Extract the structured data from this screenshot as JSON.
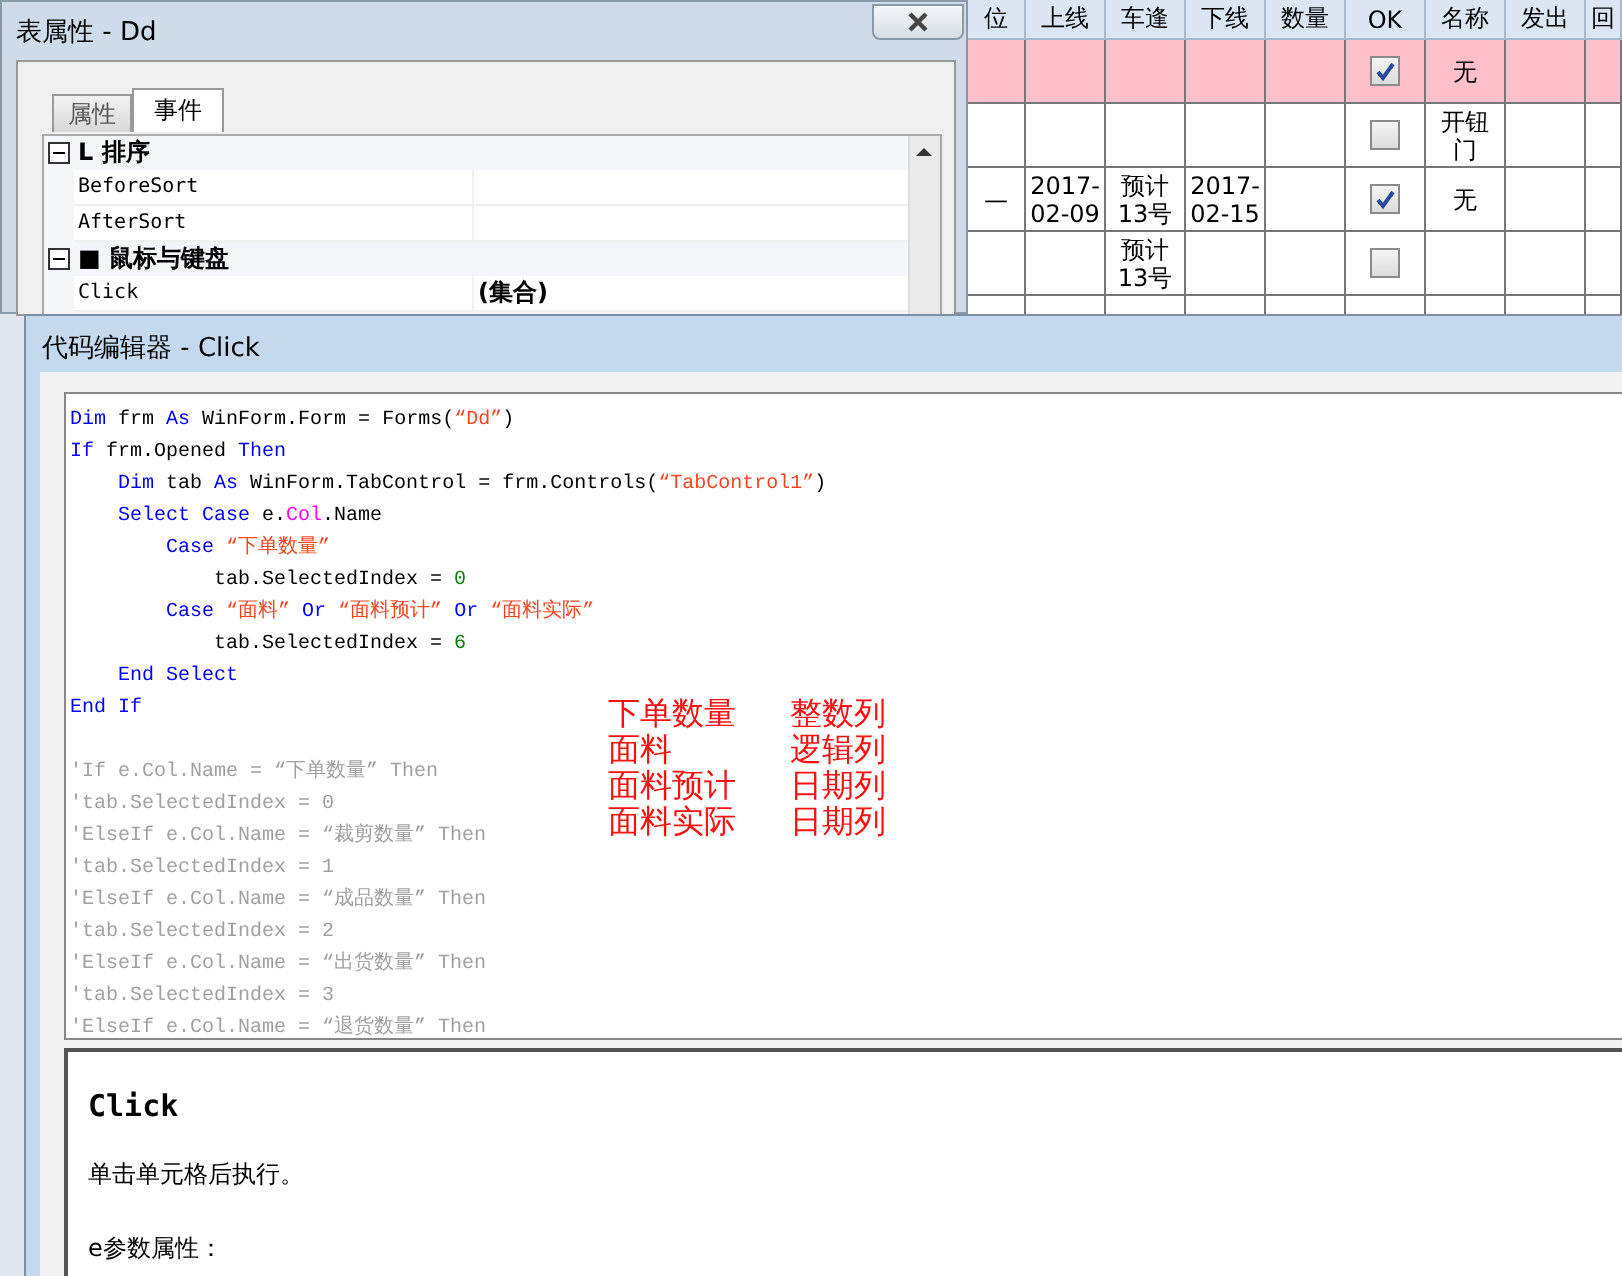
{
  "background_grid": {
    "columns": [
      "位",
      "上线",
      "车逢",
      "下线",
      "数量",
      "OK",
      "名称",
      "发出",
      "回"
    ],
    "rows": [
      {
        "selected": true,
        "cells": [
          {
            "kind": "empty"
          },
          {
            "kind": "empty"
          },
          {
            "kind": "empty"
          },
          {
            "kind": "empty"
          },
          {
            "kind": "empty"
          },
          {
            "kind": "check",
            "checked": true
          },
          {
            "kind": "text",
            "text": "无"
          },
          {
            "kind": "empty"
          },
          {
            "kind": "empty"
          }
        ]
      },
      {
        "selected": false,
        "cells": [
          {
            "kind": "empty"
          },
          {
            "kind": "empty"
          },
          {
            "kind": "empty"
          },
          {
            "kind": "empty"
          },
          {
            "kind": "empty"
          },
          {
            "kind": "check",
            "checked": false
          },
          {
            "kind": "text",
            "text": "开钮门"
          },
          {
            "kind": "empty"
          },
          {
            "kind": "empty"
          }
        ]
      },
      {
        "selected": false,
        "cells": [
          {
            "kind": "text",
            "text": "—"
          },
          {
            "kind": "text",
            "text": "2017-02-09"
          },
          {
            "kind": "text",
            "text": "预计13号"
          },
          {
            "kind": "text",
            "text": "2017-02-15"
          },
          {
            "kind": "empty"
          },
          {
            "kind": "check",
            "checked": true
          },
          {
            "kind": "text",
            "text": "无"
          },
          {
            "kind": "empty"
          },
          {
            "kind": "empty"
          }
        ]
      },
      {
        "selected": false,
        "cells": [
          {
            "kind": "empty"
          },
          {
            "kind": "empty"
          },
          {
            "kind": "text",
            "text": "预计13号"
          },
          {
            "kind": "empty"
          },
          {
            "kind": "empty"
          },
          {
            "kind": "check",
            "checked": false
          },
          {
            "kind": "empty"
          },
          {
            "kind": "empty"
          },
          {
            "kind": "empty"
          }
        ]
      }
    ]
  },
  "property_window": {
    "title": "表属性 - Dd",
    "tabs": [
      {
        "label": "属性",
        "selected": false
      },
      {
        "label": "事件",
        "selected": true
      }
    ],
    "groups": [
      {
        "label": "L 排序",
        "expanded": true,
        "items": [
          {
            "name": "BeforeSort"
          },
          {
            "name": "AfterSort"
          }
        ]
      },
      {
        "label": "■ 鼠标与键盘",
        "expanded": true,
        "items": [
          {
            "name": "Click",
            "value": "(集合)"
          }
        ]
      }
    ]
  },
  "code_editor": {
    "title": "代码编辑器 - Click",
    "lines": [
      {
        "kind": "code",
        "tokens": [
          {
            "kind": "keyword",
            "text": "Dim"
          },
          {
            "kind": "plain",
            "text": " frm "
          },
          {
            "kind": "keyword",
            "text": "As"
          },
          {
            "kind": "plain",
            "text": " WinForm.Form = Forms("
          },
          {
            "kind": "string",
            "text": "“Dd”"
          },
          {
            "kind": "plain",
            "text": ")"
          }
        ]
      },
      {
        "kind": "code",
        "tokens": [
          {
            "kind": "keyword",
            "text": "If"
          },
          {
            "kind": "plain",
            "text": " frm.Opened "
          },
          {
            "kind": "keyword",
            "text": "Then"
          }
        ]
      },
      {
        "kind": "code",
        "tokens": [
          {
            "kind": "keyword",
            "text": "    Dim"
          },
          {
            "kind": "plain",
            "text": " tab "
          },
          {
            "kind": "keyword",
            "text": "As"
          },
          {
            "kind": "plain",
            "text": " WinForm.TabControl = frm.Controls("
          },
          {
            "kind": "string",
            "text": "“TabControl1”"
          },
          {
            "kind": "plain",
            "text": ")"
          }
        ]
      },
      {
        "kind": "code",
        "tokens": [
          {
            "kind": "keyword",
            "text": "    Select Case"
          },
          {
            "kind": "plain",
            "text": " e."
          },
          {
            "kind": "member",
            "text": "Col"
          },
          {
            "kind": "plain",
            "text": ".Name"
          }
        ]
      },
      {
        "kind": "code",
        "tokens": [
          {
            "kind": "keyword",
            "text": "        Case "
          },
          {
            "kind": "string",
            "text": "“下单数量”"
          }
        ]
      },
      {
        "kind": "code",
        "tokens": [
          {
            "kind": "plain",
            "text": "            tab.SelectedIndex = "
          },
          {
            "kind": "number",
            "text": "0"
          }
        ]
      },
      {
        "kind": "code",
        "tokens": [
          {
            "kind": "keyword",
            "text": "        Case "
          },
          {
            "kind": "string",
            "text": "“面料” "
          },
          {
            "kind": "keyword",
            "text": "Or "
          },
          {
            "kind": "string",
            "text": "“面料预计” "
          },
          {
            "kind": "keyword",
            "text": "Or "
          },
          {
            "kind": "string",
            "text": "“面料实际”"
          }
        ]
      },
      {
        "kind": "code",
        "tokens": [
          {
            "kind": "plain",
            "text": "            tab.SelectedIndex = "
          },
          {
            "kind": "number",
            "text": "6"
          }
        ]
      },
      {
        "kind": "code",
        "tokens": [
          {
            "kind": "keyword",
            "text": "    End Select"
          }
        ]
      },
      {
        "kind": "code",
        "tokens": [
          {
            "kind": "keyword",
            "text": "End If"
          }
        ]
      },
      {
        "kind": "blank"
      },
      {
        "kind": "code",
        "tokens": [
          {
            "kind": "comment",
            "text": "'If e.Col.Name = “下单数量” Then"
          }
        ]
      },
      {
        "kind": "code",
        "tokens": [
          {
            "kind": "comment",
            "text": "'tab.SelectedIndex = 0"
          }
        ]
      },
      {
        "kind": "code",
        "tokens": [
          {
            "kind": "comment",
            "text": "'ElseIf e.Col.Name = “裁剪数量” Then"
          }
        ]
      },
      {
        "kind": "code",
        "tokens": [
          {
            "kind": "comment",
            "text": "'tab.SelectedIndex = 1"
          }
        ]
      },
      {
        "kind": "code",
        "tokens": [
          {
            "kind": "comment",
            "text": "'ElseIf e.Col.Name = “成品数量” Then"
          }
        ]
      },
      {
        "kind": "code",
        "tokens": [
          {
            "kind": "comment",
            "text": "'tab.SelectedIndex = 2"
          }
        ]
      },
      {
        "kind": "code",
        "tokens": [
          {
            "kind": "comment",
            "text": "'ElseIf e.Col.Name = “出货数量” Then"
          }
        ]
      },
      {
        "kind": "code",
        "tokens": [
          {
            "kind": "comment",
            "text": "'tab.SelectedIndex = 3"
          }
        ]
      },
      {
        "kind": "code",
        "tokens": [
          {
            "kind": "comment",
            "text": "'ElseIf e.Col.Name = “退货数量” Then"
          }
        ]
      }
    ],
    "annotations": [
      {
        "name": "下单数量",
        "type": "整数列"
      },
      {
        "name": "面料",
        "type": "逻辑列"
      },
      {
        "name": "面料预计",
        "type": "日期列"
      },
      {
        "name": "面料实际",
        "type": "日期列"
      }
    ],
    "help": {
      "title": "Click",
      "description": "单击单元格后执行。",
      "params_label": "e参数属性："
    }
  }
}
